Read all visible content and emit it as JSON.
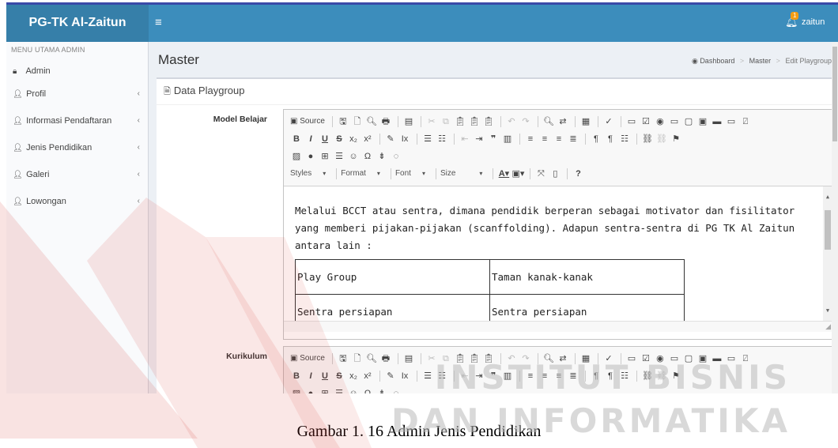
{
  "header": {
    "brand": "PG-TK Al-Zaitun",
    "menu_icon": "hamburger-icon",
    "notif_icon": "bell-icon",
    "notif_count": "1",
    "user": "zaitun"
  },
  "sidebar": {
    "header": "MENU UTAMA ADMIN",
    "items": [
      {
        "label": "Admin",
        "icon": "lock-icon",
        "has_chevron": false
      },
      {
        "label": "Profil",
        "icon": "user-icon",
        "has_chevron": true
      },
      {
        "label": "Informasi Pendaftaran",
        "icon": "user-icon",
        "has_chevron": true
      },
      {
        "label": "Jenis Pendidikan",
        "icon": "user-icon",
        "has_chevron": true
      },
      {
        "label": "Galeri",
        "icon": "user-icon",
        "has_chevron": true
      },
      {
        "label": "Lowongan",
        "icon": "user-icon",
        "has_chevron": true
      }
    ]
  },
  "content": {
    "title": "Master",
    "breadcrumb": {
      "home": "Dashboard",
      "mid": "Master",
      "current": "Edit Playgroup"
    },
    "box_title": "Data Playgroup",
    "fields": [
      {
        "label": "Model Belajar",
        "paragraph": "Melalui BCCT atau sentra, dimana pendidik berperan sebagai motivator dan fisilitator yang memberi pijakan-pijakan (scanffolding). Adapun sentra-sentra di PG TK Al Zaitun antara lain :",
        "table": [
          [
            "Play Group",
            "Taman kanak-kanak"
          ],
          [
            "Sentra persiapan",
            "Sentra persiapan"
          ]
        ]
      },
      {
        "label": "Kurikulum"
      }
    ]
  },
  "editor": {
    "source": "Source",
    "combos": [
      "Styles",
      "Format",
      "Font",
      "Size"
    ],
    "help": "?"
  },
  "watermark": {
    "line1": "INSTITUT BISNIS",
    "line2": "DAN INFORMATIKA"
  },
  "caption": "Gambar 1. 16 Admin Jenis Pendidikan"
}
